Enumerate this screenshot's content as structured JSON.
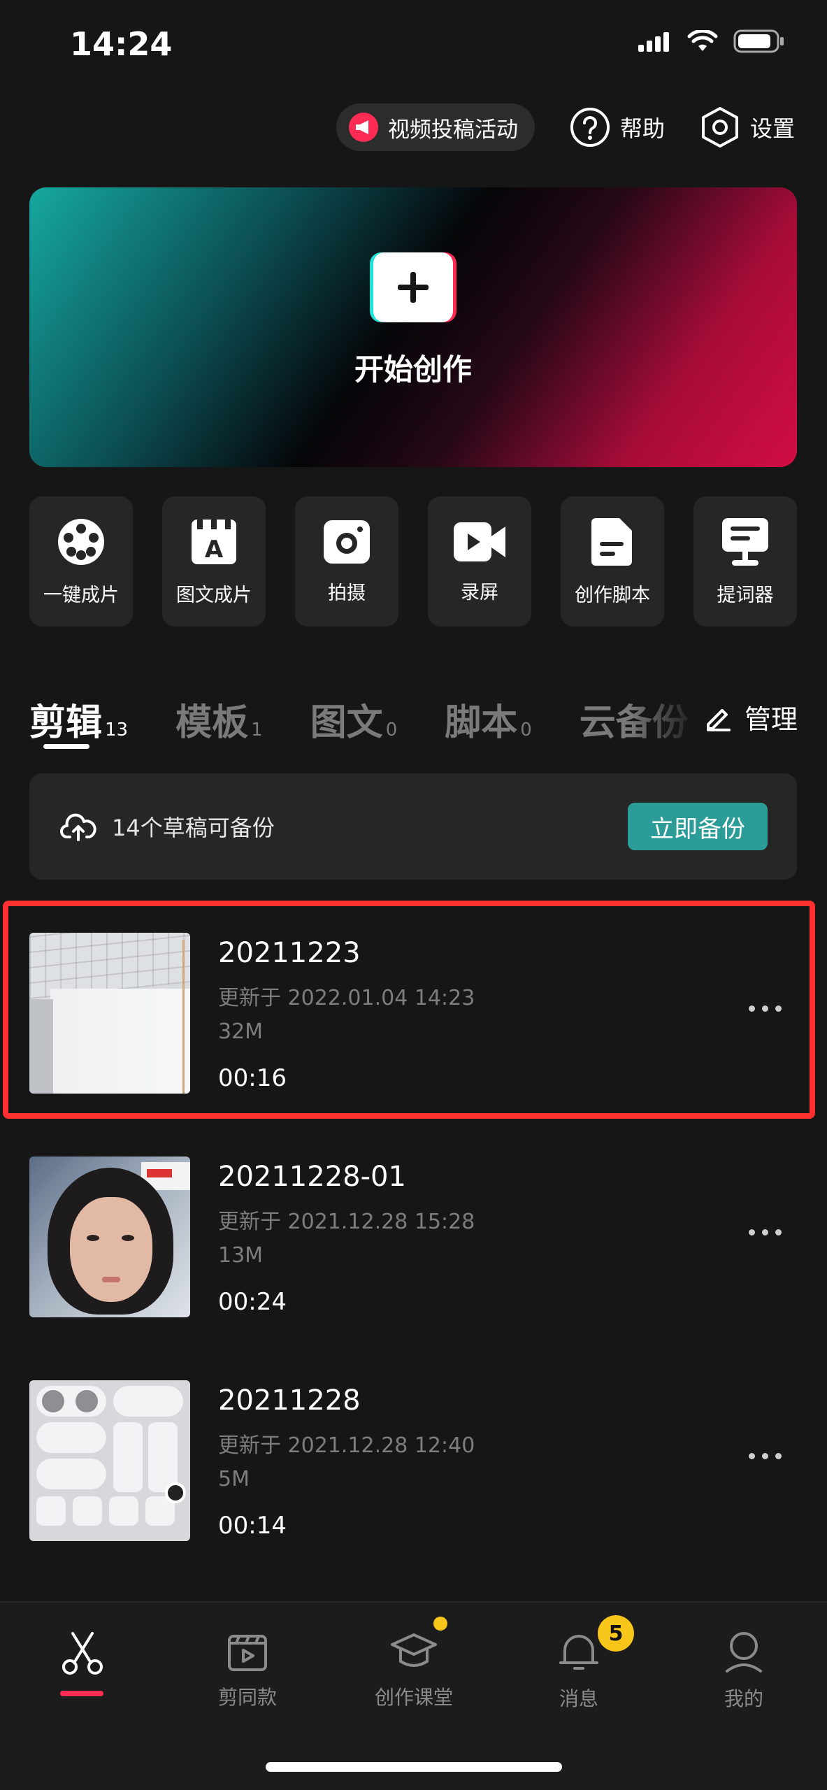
{
  "status_bar": {
    "time": "14:24"
  },
  "top_actions": {
    "campaign_label": "视频投稿活动",
    "help_label": "帮助",
    "settings_label": "设置"
  },
  "hero": {
    "label": "开始创作"
  },
  "tools": [
    {
      "label": "一键成片",
      "icon": "film-reel-icon"
    },
    {
      "label": "图文成片",
      "icon": "clapper-text-icon"
    },
    {
      "label": "拍摄",
      "icon": "camera-icon"
    },
    {
      "label": "录屏",
      "icon": "video-camera-icon"
    },
    {
      "label": "创作脚本",
      "icon": "document-icon"
    },
    {
      "label": "提词器",
      "icon": "teleprompter-icon"
    }
  ],
  "tabs": [
    {
      "name": "剪辑",
      "count": "13",
      "active": true
    },
    {
      "name": "模板",
      "count": "1"
    },
    {
      "name": "图文",
      "count": "0"
    },
    {
      "name": "脚本",
      "count": "0"
    },
    {
      "name": "云备份",
      "count": ""
    }
  ],
  "manage_label": "管理",
  "backup": {
    "text": "14个草稿可备份",
    "button": "立即备份",
    "button_color": "#2c9c98"
  },
  "drafts": [
    {
      "title": "20211223",
      "updated": "更新于 2022.01.04 14:23",
      "size": "32M",
      "duration": "00:16",
      "highlighted": true
    },
    {
      "title": "20211228-01",
      "updated": "更新于 2021.12.28 15:28",
      "size": "13M",
      "duration": "00:24"
    },
    {
      "title": "20211228",
      "updated": "更新于 2021.12.28 12:40",
      "size": "5M",
      "duration": "00:14"
    }
  ],
  "bottom_nav": [
    {
      "label": "",
      "icon": "scissors-icon",
      "active": true
    },
    {
      "label": "剪同款",
      "icon": "clapperboard-play-icon"
    },
    {
      "label": "创作课堂",
      "icon": "graduation-cap-icon",
      "dot": true
    },
    {
      "label": "消息",
      "icon": "bell-icon",
      "badge": "5"
    },
    {
      "label": "我的",
      "icon": "person-icon"
    }
  ],
  "colors": {
    "accent": "#fe2c55",
    "highlight_border": "#ff3030",
    "badge": "#f8c51a"
  }
}
